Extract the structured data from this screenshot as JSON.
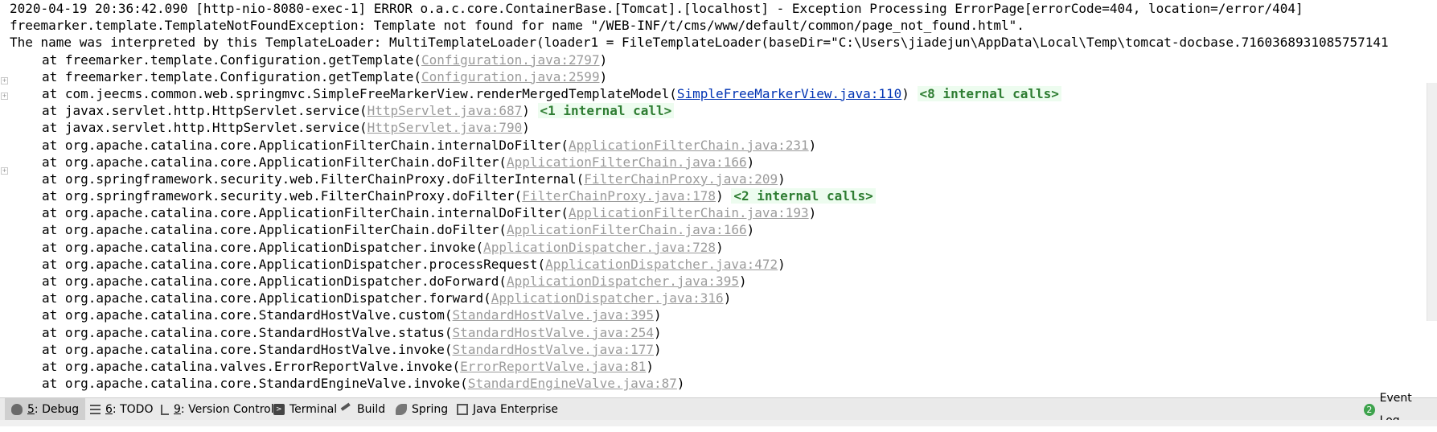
{
  "console": {
    "header_lines": [
      "2020-04-19 20:36:42.090 [http-nio-8080-exec-1] ERROR o.a.c.core.ContainerBase.[Tomcat].[localhost] - Exception Processing ErrorPage[errorCode=404, location=/error/404]",
      "freemarker.template.TemplateNotFoundException: Template not found for name \"/WEB-INF/t/cms/www/default/common/page_not_found.html\".",
      "The name was interpreted by this TemplateLoader: MultiTemplateLoader(loader1 = FileTemplateLoader(baseDir=\"C:\\Users\\jiadejun\\AppData\\Local\\Temp\\tomcat-docbase.7160368931085757141"
    ],
    "frames": [
      {
        "method": "at freemarker.template.Configuration.getTemplate(",
        "source": "Configuration.java:2797",
        "internal": ""
      },
      {
        "method": "at freemarker.template.Configuration.getTemplate(",
        "source": "Configuration.java:2599",
        "internal": ""
      },
      {
        "method": "at com.jeecms.common.web.springmvc.SimpleFreeMarkerView.renderMergedTemplateModel(",
        "source": "SimpleFreeMarkerView.java:110",
        "internal": "<8 internal calls>",
        "active": true
      },
      {
        "method": "at javax.servlet.http.HttpServlet.service(",
        "source": "HttpServlet.java:687",
        "internal": "<1 internal call>"
      },
      {
        "method": "at javax.servlet.http.HttpServlet.service(",
        "source": "HttpServlet.java:790",
        "internal": ""
      },
      {
        "method": "at org.apache.catalina.core.ApplicationFilterChain.internalDoFilter(",
        "source": "ApplicationFilterChain.java:231",
        "internal": ""
      },
      {
        "method": "at org.apache.catalina.core.ApplicationFilterChain.doFilter(",
        "source": "ApplicationFilterChain.java:166",
        "internal": ""
      },
      {
        "method": "at org.springframework.security.web.FilterChainProxy.doFilterInternal(",
        "source": "FilterChainProxy.java:209",
        "internal": ""
      },
      {
        "method": "at org.springframework.security.web.FilterChainProxy.doFilter(",
        "source": "FilterChainProxy.java:178",
        "internal": "<2 internal calls>"
      },
      {
        "method": "at org.apache.catalina.core.ApplicationFilterChain.internalDoFilter(",
        "source": "ApplicationFilterChain.java:193",
        "internal": ""
      },
      {
        "method": "at org.apache.catalina.core.ApplicationFilterChain.doFilter(",
        "source": "ApplicationFilterChain.java:166",
        "internal": ""
      },
      {
        "method": "at org.apache.catalina.core.ApplicationDispatcher.invoke(",
        "source": "ApplicationDispatcher.java:728",
        "internal": ""
      },
      {
        "method": "at org.apache.catalina.core.ApplicationDispatcher.processRequest(",
        "source": "ApplicationDispatcher.java:472",
        "internal": ""
      },
      {
        "method": "at org.apache.catalina.core.ApplicationDispatcher.doForward(",
        "source": "ApplicationDispatcher.java:395",
        "internal": ""
      },
      {
        "method": "at org.apache.catalina.core.ApplicationDispatcher.forward(",
        "source": "ApplicationDispatcher.java:316",
        "internal": ""
      },
      {
        "method": "at org.apache.catalina.core.StandardHostValve.custom(",
        "source": "StandardHostValve.java:395",
        "internal": ""
      },
      {
        "method": "at org.apache.catalina.core.StandardHostValve.status(",
        "source": "StandardHostValve.java:254",
        "internal": ""
      },
      {
        "method": "at org.apache.catalina.core.StandardHostValve.invoke(",
        "source": "StandardHostValve.java:177",
        "internal": ""
      },
      {
        "method": "at org.apache.catalina.valves.ErrorReportValve.invoke(",
        "source": "ErrorReportValve.java:81",
        "internal": ""
      },
      {
        "method": "at org.apache.catalina.core.StandardEngineValve.invoke(",
        "source": "StandardEngineValve.java:87",
        "internal": ""
      }
    ]
  },
  "toolbar": {
    "debug": {
      "mnemonic": "5",
      "label": ": Debug",
      "icon": "bug-icon"
    },
    "todo": {
      "mnemonic": "6",
      "label": ": TODO",
      "icon": "list-icon"
    },
    "vcs": {
      "mnemonic": "9",
      "label": ": Version Control",
      "icon": "branch-icon"
    },
    "terminal": {
      "label": "Terminal",
      "icon": "terminal-icon"
    },
    "build": {
      "label": "Build",
      "icon": "hammer-icon"
    },
    "spring": {
      "label": "Spring",
      "icon": "leaf-icon"
    },
    "java_ee": {
      "label": "Java Enterprise",
      "icon": "java-ee-icon"
    },
    "event_log": {
      "count": "2",
      "label": "Event Log",
      "icon": "event-log-icon"
    }
  },
  "colors": {
    "link_active": "#0033b3",
    "link_inactive": "#9b9b9b",
    "internal_calls": "#2e7d32",
    "internal_bg": "#edfcef"
  }
}
